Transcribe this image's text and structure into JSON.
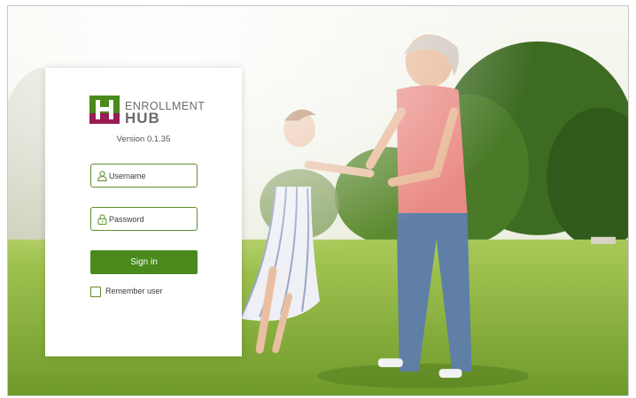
{
  "brand": {
    "name_top": "ENROLLMENT",
    "name_bottom": "HUB",
    "version": "Version 0.1.35",
    "logo_icon": "enrollment-hub-logo-icon",
    "colors": {
      "mark_green": "#4a8a1d",
      "mark_purple": "#9b1c52",
      "text_gray": "#6b6b6b"
    }
  },
  "login": {
    "username_placeholder": "Username",
    "username_icon": "user-icon",
    "password_placeholder": "Password",
    "password_icon": "lock-icon",
    "sign_in_label": "Sign in",
    "remember_label": "Remember user",
    "remember_checked": false,
    "accent_color": "#4a8a1d"
  }
}
